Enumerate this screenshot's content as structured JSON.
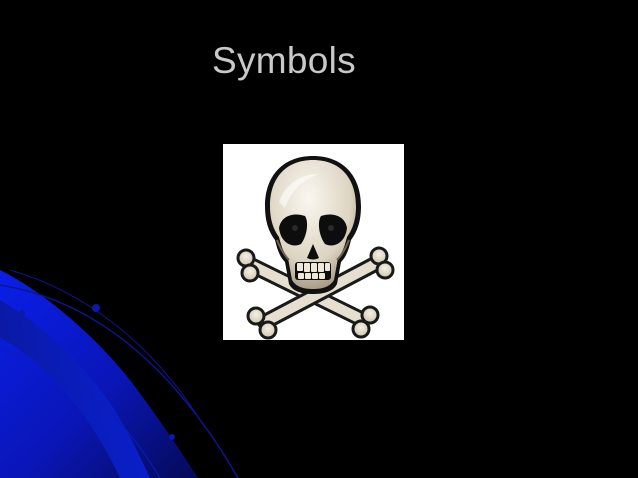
{
  "slide": {
    "title": "Symbols",
    "background_color": "#000000",
    "accent_color": "#0a1bd6",
    "title_color": "#c9c9c9"
  },
  "picture": {
    "icon": "skull-and-crossbones-icon"
  }
}
